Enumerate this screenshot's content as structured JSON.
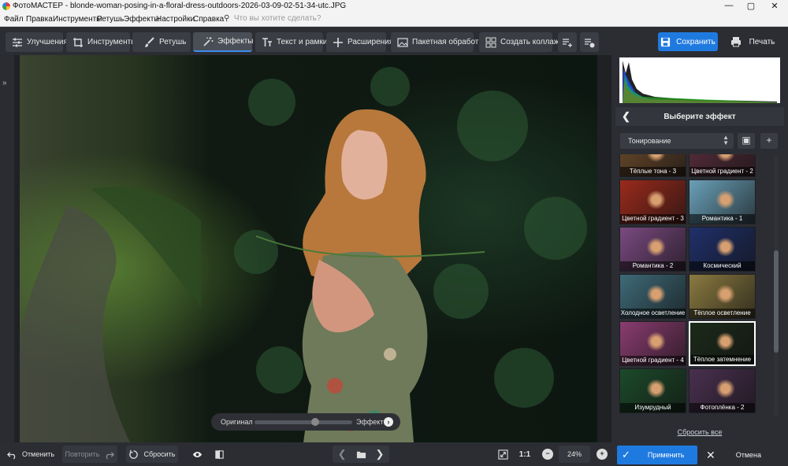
{
  "titlebar": {
    "title": "ФотоМАСТЕР - blonde-woman-posing-in-a-floral-dress-outdoors-2026-03-09-02-51-34-utc.JPG",
    "minimize": "—",
    "maximize": "▢",
    "close": "✕"
  },
  "menu": {
    "items": [
      "Файл",
      "Правка",
      "Инструменты",
      "Ретушь",
      "Эффекты",
      "Настройки",
      "Справка"
    ],
    "search_placeholder": "Что вы хотите сделать?"
  },
  "toolbar": {
    "tabs": [
      "Улучшения",
      "Инструменты",
      "Ретушь",
      "Эффекты",
      "Текст и рамки",
      "Расширения"
    ],
    "active_tab": "Эффекты",
    "batch": "Пакетная обработка",
    "collage": "Создать коллаж",
    "save": "Сохранить",
    "print": "Печать"
  },
  "compare": {
    "original": "Оригинал",
    "effect": "Эффект",
    "mix": 0.62
  },
  "panel": {
    "title": "Выберите эффект",
    "category": "Тонирование",
    "reset_all": "Сбросить все",
    "effects": [
      {
        "label": "Тёплые тона - 3",
        "tint": "#6b4a2c"
      },
      {
        "label": "Цветной градиент - 2",
        "tint": "#5a2e3c"
      },
      {
        "label": "Цветной градиент - 3",
        "tint": "#9a2a1c"
      },
      {
        "label": "Романтика - 1",
        "tint": "#6aa0b8"
      },
      {
        "label": "Романтика - 2",
        "tint": "#7a4a80"
      },
      {
        "label": "Космический",
        "tint": "#20306a"
      },
      {
        "label": "Холодное осветление",
        "tint": "#3e6a78"
      },
      {
        "label": "Тёплое осветление",
        "tint": "#8a7a40"
      },
      {
        "label": "Цветной градиент - 4",
        "tint": "#8a3c70"
      },
      {
        "label": "Тёплое затемнение",
        "tint": "#1c2a1a"
      },
      {
        "label": "Изумрудный",
        "tint": "#1c4a2a"
      },
      {
        "label": "Фотоплёнка - 2",
        "tint": "#4a3050"
      }
    ],
    "selected_effect": "Тёплое затемнение"
  },
  "bottom": {
    "undo": "Отменить",
    "redo": "Повторить",
    "reset": "Сбросить",
    "zoom_fit": "1:1",
    "zoom": "24%",
    "apply": "Применить",
    "cancel": "Отмена"
  },
  "colors": {
    "accent": "#1f7ae0",
    "panel": "#2b2d33"
  }
}
